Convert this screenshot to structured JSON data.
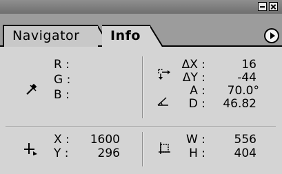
{
  "tabs": [
    {
      "label": "Navigator",
      "active": false
    },
    {
      "label": "Info",
      "active": true
    }
  ],
  "color_readout": {
    "labels": [
      "R :",
      "G :",
      "B :"
    ],
    "icon": "eyedropper-icon"
  },
  "measure_readout": {
    "dx": {
      "label": "ΔX :",
      "value": "16"
    },
    "dy": {
      "label": "ΔY :",
      "value": "-44"
    },
    "angle": {
      "label": "A :",
      "value": "70.0°"
    },
    "distance": {
      "label": "D :",
      "value": "46.82"
    },
    "icons": [
      "move-offset-icon",
      "angle-icon"
    ]
  },
  "position_readout": {
    "x": {
      "label": "X :",
      "value": "1600"
    },
    "y": {
      "label": "Y :",
      "value": "296"
    },
    "icon": "crosshair-icon"
  },
  "size_readout": {
    "w": {
      "label": "W :",
      "value": "556"
    },
    "h": {
      "label": "H :",
      "value": "404"
    },
    "icon": "selection-size-icon"
  },
  "colors": {
    "panel_bg": "#d4d4d4",
    "titlebar": "#7a7a7a",
    "tabstrip": "#9c9c9c"
  }
}
